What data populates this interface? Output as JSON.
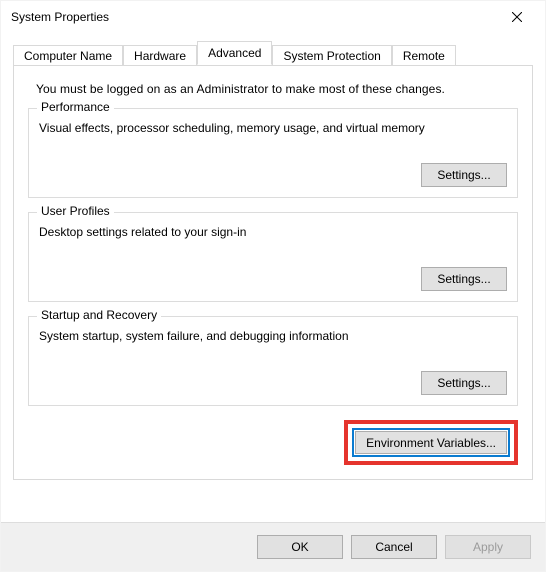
{
  "window": {
    "title": "System Properties"
  },
  "tabs": {
    "computer_name": "Computer Name",
    "hardware": "Hardware",
    "advanced": "Advanced",
    "system_protection": "System Protection",
    "remote": "Remote"
  },
  "advanced_panel": {
    "intro": "You must be logged on as an Administrator to make most of these changes.",
    "performance": {
      "legend": "Performance",
      "desc": "Visual effects, processor scheduling, memory usage, and virtual memory",
      "settings_label": "Settings..."
    },
    "user_profiles": {
      "legend": "User Profiles",
      "desc": "Desktop settings related to your sign-in",
      "settings_label": "Settings..."
    },
    "startup_recovery": {
      "legend": "Startup and Recovery",
      "desc": "System startup, system failure, and debugging information",
      "settings_label": "Settings..."
    },
    "env_vars_label": "Environment Variables..."
  },
  "footer": {
    "ok": "OK",
    "cancel": "Cancel",
    "apply": "Apply"
  }
}
